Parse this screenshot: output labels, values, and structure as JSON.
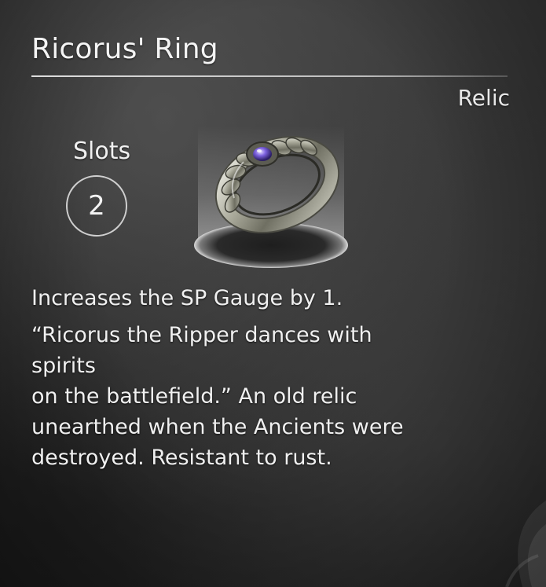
{
  "item": {
    "name": "Ricorus' Ring",
    "category": "Relic",
    "slots_label": "Slots",
    "slots_value": "2",
    "effect": "Increases the SP Gauge by 1.",
    "flavor": "“Ricorus the Ripper dances with spirits\non the battlefield.” An old relic\nunearthed when the Ancients were\ndestroyed. Resistant to rust.",
    "gem_color": "#6a4fd0"
  },
  "icons": {
    "item": "ring-icon",
    "emblem": "corner-emblem-icon"
  }
}
